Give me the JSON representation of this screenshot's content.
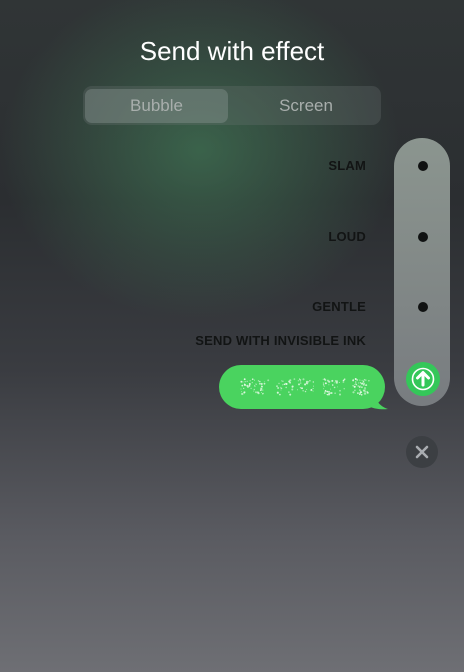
{
  "header": {
    "title": "Send with effect"
  },
  "tabs": [
    {
      "label": "Bubble",
      "selected": true
    },
    {
      "label": "Screen",
      "selected": false
    }
  ],
  "effects": [
    {
      "label": "SLAM"
    },
    {
      "label": "LOUD"
    },
    {
      "label": "GENTLE"
    },
    {
      "label": "SEND WITH INVISIBLE INK",
      "selected": true
    }
  ],
  "message": {
    "style": "invisible-ink",
    "bubble_color": "#4ad35f"
  },
  "icons": {
    "send": "arrow-up-icon",
    "close": "close-icon"
  },
  "colors": {
    "accent": "#34c759"
  }
}
